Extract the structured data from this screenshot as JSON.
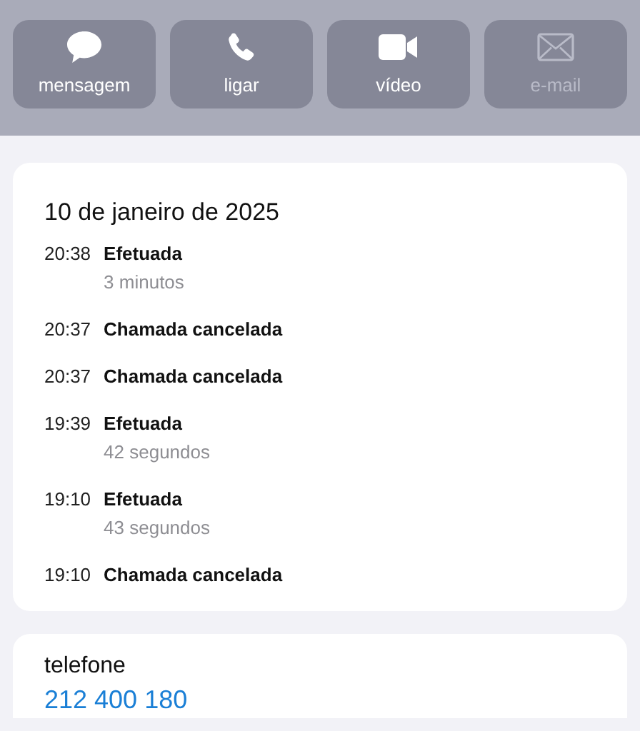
{
  "actions": [
    {
      "kind": "message",
      "label": "mensagem",
      "disabled": false
    },
    {
      "kind": "call",
      "label": "ligar",
      "disabled": false
    },
    {
      "kind": "video",
      "label": "vídeo",
      "disabled": false
    },
    {
      "kind": "email",
      "label": "e-mail",
      "disabled": true
    }
  ],
  "call_history": {
    "date": "10 de janeiro de 2025",
    "calls": [
      {
        "time": "20:38",
        "status": "Efetuada",
        "duration": "3 minutos"
      },
      {
        "time": "20:37",
        "status": "Chamada cancelada"
      },
      {
        "time": "20:37",
        "status": "Chamada cancelada"
      },
      {
        "time": "19:39",
        "status": "Efetuada",
        "duration": "42 segundos"
      },
      {
        "time": "19:10",
        "status": "Efetuada",
        "duration": "43 segundos"
      },
      {
        "time": "19:10",
        "status": "Chamada cancelada"
      }
    ]
  },
  "phone": {
    "label": "telefone",
    "number": "212 400 180"
  }
}
